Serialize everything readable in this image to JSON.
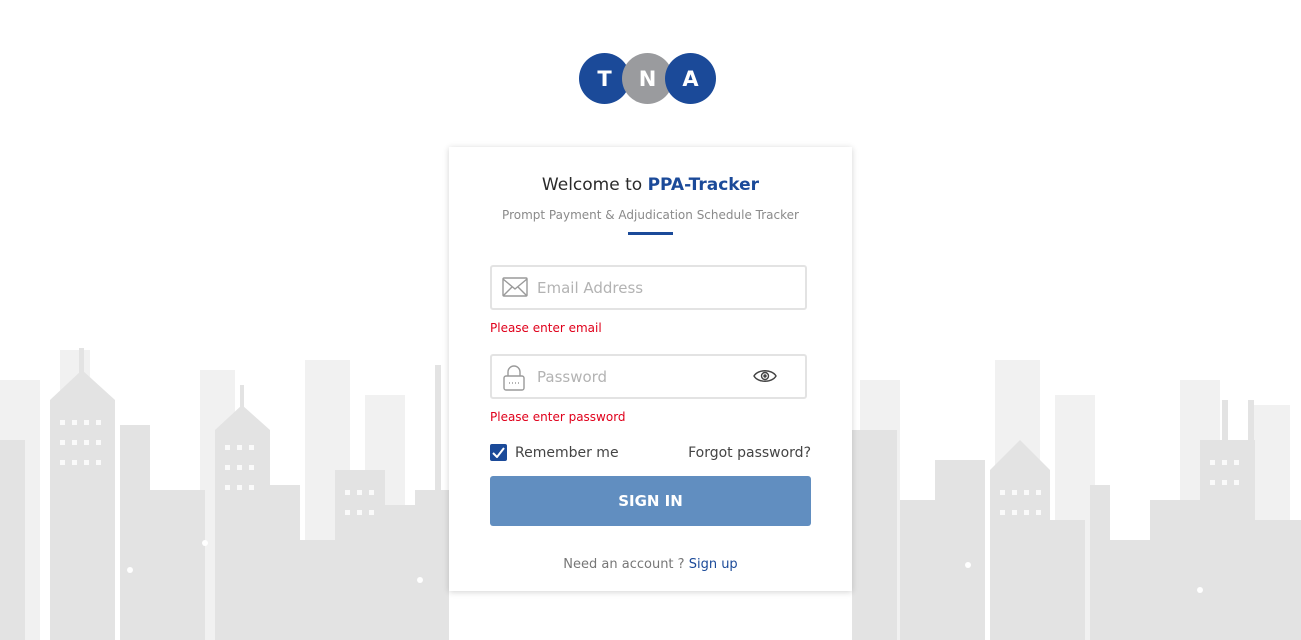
{
  "logo": {
    "letters": [
      "T",
      "N",
      "A"
    ],
    "colors": [
      "#1b4a99",
      "#9a9b9e",
      "#1b4a99"
    ]
  },
  "card": {
    "welcome_prefix": "Welcome to ",
    "brand": "PPA-Tracker",
    "subtitle": "Prompt Payment & Adjudication Schedule Tracker"
  },
  "form": {
    "email": {
      "placeholder": "Email Address",
      "value": "",
      "error": "Please enter email",
      "icon": "envelope-icon"
    },
    "password": {
      "placeholder": "Password",
      "value": "",
      "error": "Please enter password",
      "icon": "lock-icon",
      "toggle_icon": "eye-icon"
    },
    "remember_label": "Remember me",
    "remember_checked": true,
    "forgot_label": "Forgot password?",
    "signin_label": "SIGN IN",
    "need_account": "Need an account ? ",
    "signup_label": "Sign up"
  },
  "colors": {
    "brand": "#1b4a99",
    "button": "#618ec0",
    "error": "#e0001b",
    "skyline": "#e8e8e8"
  }
}
